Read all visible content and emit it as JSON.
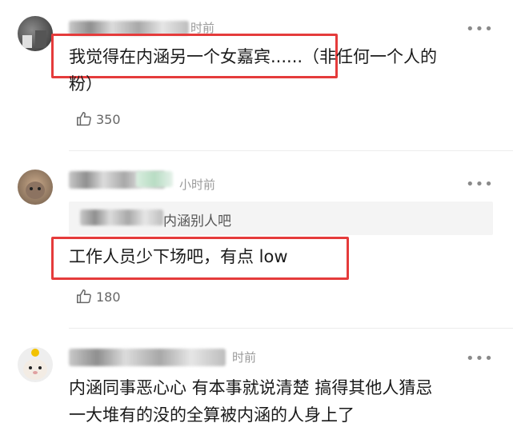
{
  "comments": [
    {
      "time": "时前",
      "text_line1": "我觉得在内涵另一个女嘉宾......（非任何一个人的",
      "text_line2": "粉）",
      "likes": "350"
    },
    {
      "time": "小时前",
      "quote": "内涵别人吧",
      "text": "工作人员少下场吧，有点 low",
      "likes": "180"
    },
    {
      "time": "时前",
      "text_line1": "内涵同事恶心心 有本事就说清楚 搞得其他人猜忌",
      "text_line2": "一大堆有的没的全算被内涵的人身上了"
    }
  ],
  "icons": {
    "like": "thumbs-up-icon",
    "more": "more-dots-icon"
  },
  "colors": {
    "highlight": "#e53b3b",
    "meta": "#9a9a9a"
  },
  "more_glyph": "•••"
}
